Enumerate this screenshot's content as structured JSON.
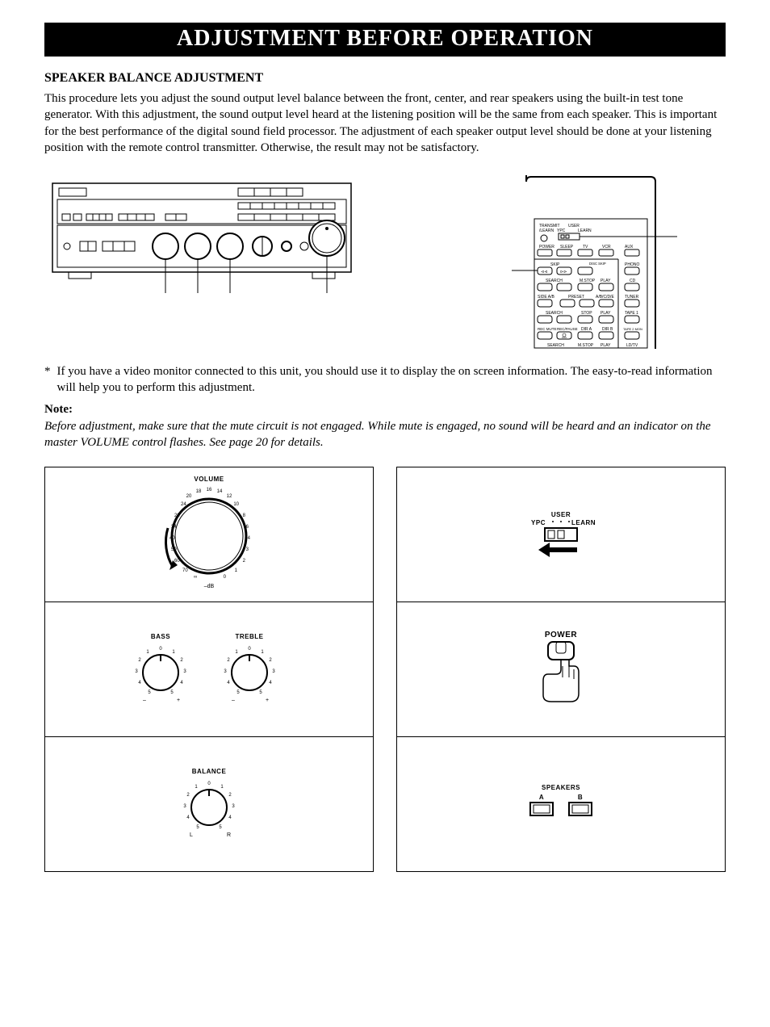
{
  "banner": "ADJUSTMENT BEFORE OPERATION",
  "section_title": "SPEAKER BALANCE ADJUSTMENT",
  "intro": "This procedure lets you adjust the sound output level balance between the front, center, and rear speakers using the built-in test tone generator. With this adjustment, the sound output level heard at the listening position will be the same from each speaker. This is important for the best performance of the digital sound field processor. The adjustment of each speaker output level should be done at your listening position with the remote control transmitter. Otherwise, the result may not be satisfactory.",
  "asterisk": "*",
  "asterisk_text": "If you have a video monitor connected to this unit, you should use it to display the on screen information. The easy-to-read information will help you to perform this adjustment.",
  "note_label": "Note:",
  "note_body": "Before adjustment, make sure that the mute circuit is not engaged. While mute is engaged, no sound will be heard and an indicator on the master VOLUME control flashes. See page 20 for details.",
  "controls": {
    "volume": "VOLUME",
    "volume_db": "–dB",
    "bass": "BASS",
    "treble": "TREBLE",
    "balance": "BALANCE",
    "user": "USER",
    "ypc": "YPC",
    "learn": "LEARN",
    "power": "POWER",
    "speakers": "SPEAKERS",
    "spk_a": "A",
    "spk_b": "B"
  },
  "remote": {
    "transmit": "TRANSMIT",
    "learn_ind": "/LEARN",
    "user": "USER",
    "ypc": "YPC",
    "learn": "LEARN",
    "power": "POWER",
    "sleep": "SLEEP",
    "tv": "TV",
    "vcr": "VCR",
    "aux": "AUX",
    "skip": "SKIP",
    "disc_skip": "DISC SKIP",
    "phono": "PHONO",
    "search": "SEARCH",
    "mstop": "M.STOP",
    "play": "PLAY",
    "cd": "CD",
    "side_ab": "SIDE A/B",
    "preset": "PRESET",
    "abcde": "A/B/C/D/E",
    "tuner": "TUNER",
    "stop": "STOP",
    "tape1": "TAPE 1",
    "rec_mute": "REC MUTE",
    "rec_pause": "REC/PAUSE",
    "dir_a": "DIR A",
    "dir_b": "DIR B",
    "tape2mon": "TAPE 2 MON",
    "ldtv": "LD/TV"
  }
}
